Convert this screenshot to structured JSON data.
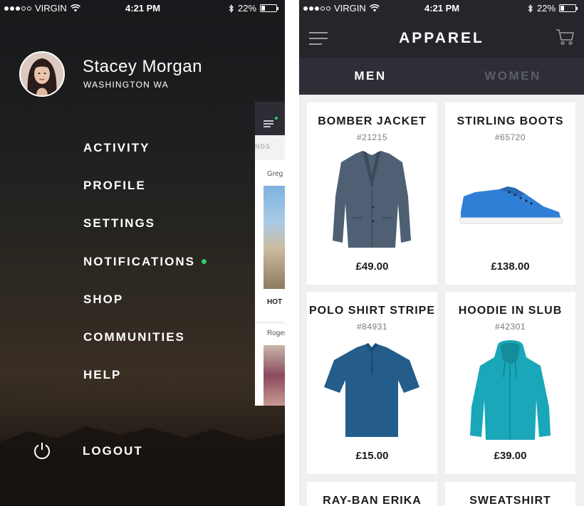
{
  "status_bar": {
    "carrier": "VIRGIN",
    "time": "4:21 PM",
    "battery": "22%"
  },
  "drawer": {
    "user": {
      "name": "Stacey Morgan",
      "location": "WASHINGTON WA"
    },
    "menu": [
      {
        "label": "ACTIVITY"
      },
      {
        "label": "PROFILE"
      },
      {
        "label": "SETTINGS"
      },
      {
        "label": "NOTIFICATIONS",
        "has_dot": true
      },
      {
        "label": "SHOP"
      },
      {
        "label": "COMMUNITIES"
      },
      {
        "label": "HELP"
      }
    ],
    "logout_label": "LOGOUT",
    "peek_panel": {
      "tab_fragment": "NDS",
      "author_1": "Greg I",
      "headline_fragment": "HOT",
      "author_2": "Roger"
    }
  },
  "apparel": {
    "title": "APPAREL",
    "tabs": [
      {
        "label": "MEN",
        "active": true
      },
      {
        "label": "WOMEN",
        "active": false
      }
    ],
    "products": [
      {
        "name": "BOMBER JACKET",
        "sku": "#21215",
        "price": "£49.00",
        "icon": "jacket-image"
      },
      {
        "name": "STIRLING BOOTS",
        "sku": "#65720",
        "price": "£138.00",
        "icon": "sneaker-image"
      },
      {
        "name": "POLO SHIRT STRIPE",
        "sku": "#84931",
        "price": "£15.00",
        "icon": "polo-shirt-image"
      },
      {
        "name": "HOODIE IN SLUB",
        "sku": "#42301",
        "price": "£39.00",
        "icon": "hoodie-image"
      },
      {
        "name": "RAY-BAN ERIKA",
        "sku": "",
        "price": "",
        "icon": ""
      },
      {
        "name": "SWEATSHIRT",
        "sku": "",
        "price": "",
        "icon": ""
      }
    ]
  },
  "colors": {
    "accent_green": "#2fce6b",
    "header_dark": "#25262c",
    "tab_bar": "#2e2f36",
    "jacket": "#4f6074",
    "sneaker": "#2f7fd6",
    "polo": "#245d8a",
    "hoodie": "#19a7b9"
  }
}
